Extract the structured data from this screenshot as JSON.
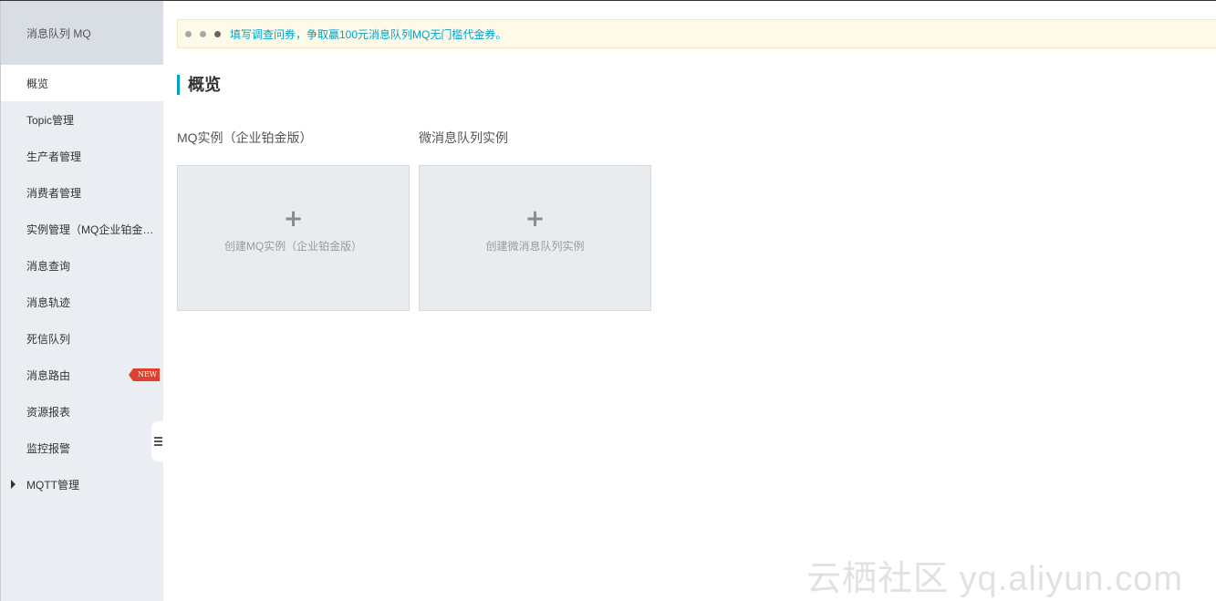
{
  "sidebar": {
    "title": "消息队列 MQ",
    "items": [
      {
        "label": "概览",
        "active": true
      },
      {
        "label": "Topic管理"
      },
      {
        "label": "生产者管理"
      },
      {
        "label": "消费者管理"
      },
      {
        "label": "实例管理（MQ企业铂金版）"
      },
      {
        "label": "消息查询"
      },
      {
        "label": "消息轨迹"
      },
      {
        "label": "死信队列"
      },
      {
        "label": "消息路由",
        "badge": "NEW"
      },
      {
        "label": "资源报表"
      },
      {
        "label": "监控报警"
      },
      {
        "label": "MQTT管理",
        "expandable": true
      }
    ]
  },
  "notice": {
    "text": "填写调查问券，争取赢100元消息队列MQ无门槛代金券。",
    "color": "#00a2ca"
  },
  "main": {
    "title": "概览",
    "sections": [
      {
        "label": "MQ实例（企业铂金版）",
        "card_icon": "plus-icon",
        "card_label": "创建MQ实例（企业铂金版）"
      },
      {
        "label": "微消息队列实例",
        "card_icon": "plus-icon",
        "card_label": "创建微消息队列实例"
      }
    ]
  },
  "watermark": "云栖社区 yq.aliyun.com",
  "colors": {
    "accent": "#00a2ca",
    "badge": "#e0412f",
    "sidebar_bg": "#eaedf1"
  }
}
